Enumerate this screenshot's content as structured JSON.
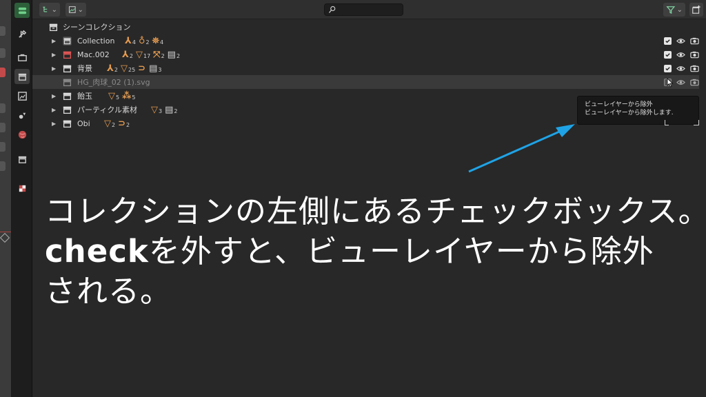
{
  "header": {
    "search_placeholder": "",
    "filter_icon": "funnel-icon",
    "new_collection_icon": "new-collection-icon"
  },
  "outliner": {
    "scene_collection_label": "シーンコレクション",
    "rows": [
      {
        "label": "Collection",
        "children": [
          {
            "icon": "armature",
            "count": "4"
          },
          {
            "icon": "light",
            "count": "2"
          },
          {
            "icon": "camera",
            "count": "4"
          }
        ]
      },
      {
        "label": "Mac.002",
        "children": [
          {
            "icon": "armature",
            "count": "2"
          },
          {
            "icon": "mesh",
            "count": "17"
          },
          {
            "icon": "empty",
            "count": "2"
          },
          {
            "icon": "collection",
            "count": "2"
          }
        ]
      },
      {
        "label": "背景",
        "children": [
          {
            "icon": "armature",
            "count": "2"
          },
          {
            "icon": "mesh",
            "count": "25"
          },
          {
            "icon": "curve",
            "count": ""
          },
          {
            "icon": "collection",
            "count": "3"
          }
        ]
      },
      {
        "label": "HG_肉球_02 (1).svg",
        "children": []
      },
      {
        "label": "飴玉",
        "children": [
          {
            "icon": "mesh",
            "count": "5"
          },
          {
            "icon": "particles",
            "count": "5"
          }
        ]
      },
      {
        "label": "パーティクル素材",
        "children": [
          {
            "icon": "mesh",
            "count": "3"
          },
          {
            "icon": "collection",
            "count": "2"
          }
        ]
      },
      {
        "label": "Obi",
        "children": [
          {
            "icon": "mesh",
            "count": "2"
          },
          {
            "icon": "curve",
            "count": "2"
          }
        ]
      }
    ]
  },
  "tooltip": {
    "title": "ビューレイヤーから除外",
    "description": "ビューレイヤーから除外します."
  },
  "caption": {
    "line1": "コレクションの左側にあるチェックボックス。",
    "line2_bold": "check",
    "line2_rest": "を外すと、ビューレイヤーから除外",
    "line3": "される。"
  },
  "colors": {
    "accent_arrow": "#1fa3e6",
    "object_data": "#e39a50",
    "red_collection": "#e05656"
  }
}
